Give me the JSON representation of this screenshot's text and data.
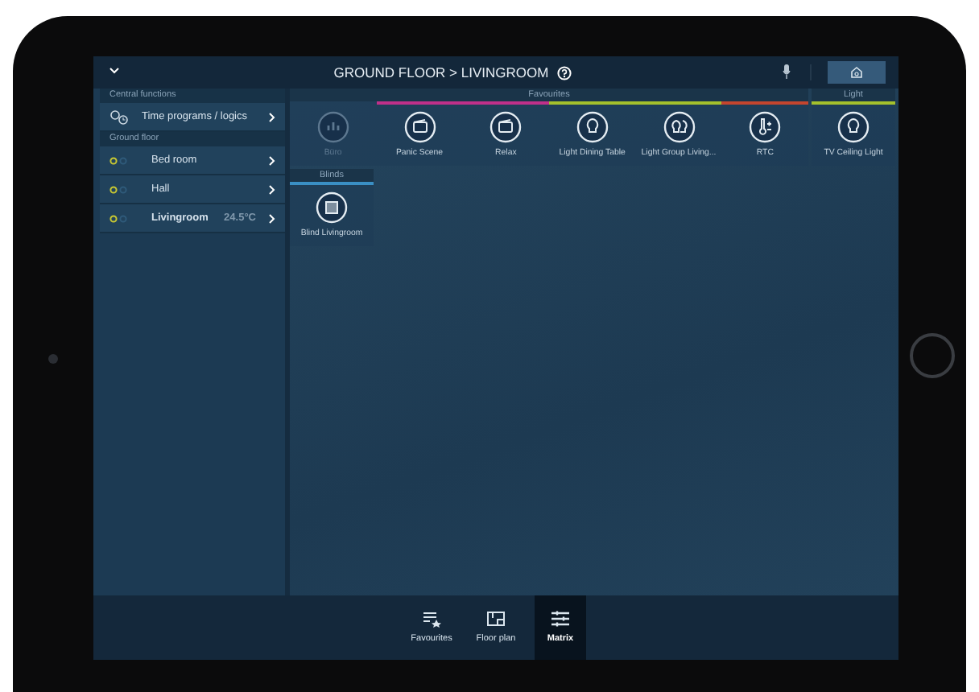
{
  "top_bar": {
    "title": "GROUND FLOOR > LIVINGROOM"
  },
  "sidebar": {
    "sections": [
      {
        "header": "Central functions",
        "items": [
          {
            "kind": "function",
            "label": "Time programs / logics",
            "selected": false
          }
        ]
      },
      {
        "header": "Ground floor",
        "items": [
          {
            "kind": "room",
            "label": "Bed room",
            "selected": false
          },
          {
            "kind": "room",
            "label": "Hall",
            "selected": false
          },
          {
            "kind": "room",
            "label": "Livingroom",
            "reading": "24.5°C",
            "selected": true
          }
        ]
      }
    ]
  },
  "groups": [
    {
      "title": "Favourites",
      "tiles": [
        {
          "kind": "chart",
          "label": "Büro",
          "disabled": true
        },
        {
          "kind": "scene",
          "label": "Panic Scene",
          "disabled": false,
          "color": "#c0308a"
        },
        {
          "kind": "scene",
          "label": "Relax",
          "disabled": false,
          "color": "#c0308a"
        },
        {
          "kind": "bulb",
          "label": "Light Dining Table",
          "disabled": false,
          "color": "#a4c12c"
        },
        {
          "kind": "bulbs",
          "label": "Light Group Living...",
          "disabled": false,
          "color": "#a4c12c"
        },
        {
          "kind": "thermo",
          "label": "RTC",
          "disabled": false,
          "color": "#c4452e"
        }
      ]
    },
    {
      "title": "Light",
      "tiles": [
        {
          "kind": "bulb",
          "label": "TV Ceiling Light",
          "disabled": false,
          "color": "#a4c12c"
        }
      ]
    },
    {
      "title": "Blinds",
      "tiles": [
        {
          "kind": "blind",
          "label": "Blind Livingroom",
          "disabled": false,
          "color": "#3a8fc4"
        }
      ]
    }
  ],
  "bottom_tabs": [
    {
      "kind": "favourites",
      "label": "Favourites",
      "selected": false
    },
    {
      "kind": "floorplan",
      "label": "Floor plan",
      "selected": false
    },
    {
      "kind": "matrix",
      "label": "Matrix",
      "selected": true
    }
  ]
}
